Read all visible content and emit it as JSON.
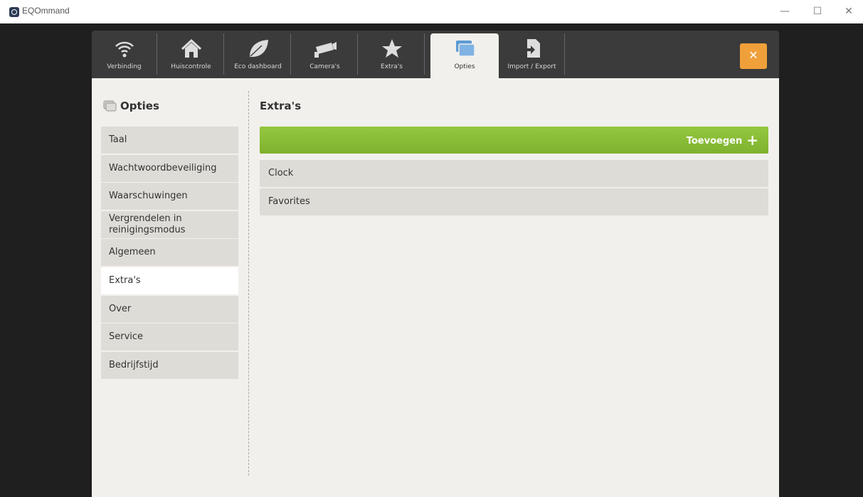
{
  "window": {
    "title": "EQOmmand",
    "minimize_label": "—",
    "maximize_label": "☐",
    "close_label": "✕"
  },
  "tabs": [
    {
      "label": "Verbinding",
      "icon": "wifi-icon"
    },
    {
      "label": "Huiscontrole",
      "icon": "home-icon"
    },
    {
      "label": "Eco dashboard",
      "icon": "leaf-icon"
    },
    {
      "label": "Camera's",
      "icon": "camera-icon"
    },
    {
      "label": "Extra's",
      "icon": "star-icon"
    },
    {
      "label": "Opties",
      "icon": "windows-icon",
      "active": true
    },
    {
      "label": "Import / Export",
      "icon": "import-export-icon"
    }
  ],
  "close_button_label": "✕",
  "sidebar": {
    "title": "Opties",
    "items": [
      {
        "label": "Taal"
      },
      {
        "label": "Wachtwoordbeveiliging"
      },
      {
        "label": "Waarschuwingen"
      },
      {
        "label": "Vergrendelen in reinigingsmodus"
      },
      {
        "label": "Algemeen"
      },
      {
        "label": "Extra's",
        "active": true
      },
      {
        "label": "Over"
      },
      {
        "label": "Service"
      },
      {
        "label": "Bedrijfstijd"
      }
    ]
  },
  "main": {
    "title": "Extra's",
    "add_label": "Toevoegen",
    "add_icon": "+",
    "items": [
      {
        "label": "Clock"
      },
      {
        "label": "Favorites"
      }
    ]
  },
  "colors": {
    "accent_green": "#8cc13a",
    "close_orange": "#f0a03a",
    "active_tab_icon": "#5b9bd5"
  }
}
